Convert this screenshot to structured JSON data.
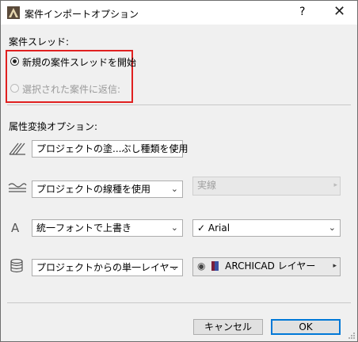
{
  "window": {
    "title": "案件インポートオプション",
    "help": "?",
    "close": "✕"
  },
  "thread": {
    "heading": "案件スレッド:",
    "options": [
      {
        "label": "新規の案件スレッドを開始",
        "checked": true,
        "enabled": true
      },
      {
        "label": "選択された案件に返信:",
        "checked": false,
        "enabled": false
      }
    ]
  },
  "conversion": {
    "heading": "属性変換オプション:",
    "rows": [
      {
        "icon": "fill-hatch-icon",
        "select": "プロジェクトの塗...ぶし種類を使用",
        "chevron": "⌄"
      },
      {
        "icon": "line-type-icon",
        "select": "プロジェクトの線種を使用",
        "chevron": "⌄",
        "secondary": "実線",
        "secondary_arrow": "▸"
      },
      {
        "icon": "font-icon",
        "glyph": "A",
        "select": "統一フォントで上書き",
        "chevron": "⌄",
        "font_check": "✓",
        "font_value": "Arial"
      },
      {
        "icon": "layers-icon",
        "select": "プロジェクトからの単一レイヤー",
        "chevron": "⌄",
        "layer_eye": "◉",
        "layer_value": "ARCHICAD レイヤー",
        "layer_arrow": "▸"
      }
    ]
  },
  "buttons": {
    "cancel": "キャンセル",
    "ok": "OK"
  }
}
